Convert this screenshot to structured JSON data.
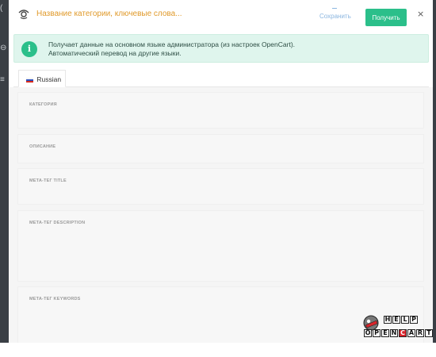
{
  "header": {
    "title": "Название категории, ключевые слова...",
    "save_label": "Сохранить",
    "get_label": "Получить",
    "close_label": "×"
  },
  "alert": {
    "icon": "i",
    "line1": "Получает данные на основном языке администратора (из настроек OpenCart).",
    "line2": "Автоматический перевод на другие языки."
  },
  "tabs": [
    {
      "label": "Russian",
      "active": true
    }
  ],
  "fields": [
    {
      "label": "КАТЕГОРИЯ"
    },
    {
      "label": "ОПИСАНИЕ"
    },
    {
      "label": "МЕТА-ТЕГ TITLE"
    },
    {
      "label": "МЕТА-ТЕГ DESCRIPTION"
    },
    {
      "label": "МЕТА-ТЕГ KEYWORDS"
    }
  ],
  "watermark": {
    "line1": "HELP",
    "line2": "OPENCART",
    "icon": "helpopencart-logo-icon"
  },
  "colors": {
    "accent": "#2bbf8a",
    "title": "#e09a2b",
    "alert_bg": "#dff5ed"
  }
}
